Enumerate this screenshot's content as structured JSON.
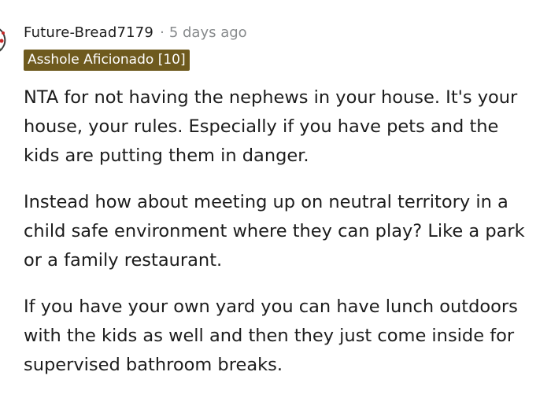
{
  "comment": {
    "username": "Future-Bread7179",
    "separator": "·",
    "timestamp": "5 days ago",
    "flair": "Asshole Aficionado [10]",
    "flair_color": "#6e5a1e",
    "avatar_icon": "snoo-avatar-icon",
    "paragraphs": [
      "NTA for not having the nephews in your house. It's your house, your rules. Especially if you have pets and the kids are putting them in danger.",
      "Instead how about meeting up on neutral territory in a child safe environment where they can play? Like a park or a family restaurant.",
      "If you have your own yard you can have lunch outdoors with the kids as well and then they just come inside for supervised bathroom breaks."
    ]
  }
}
